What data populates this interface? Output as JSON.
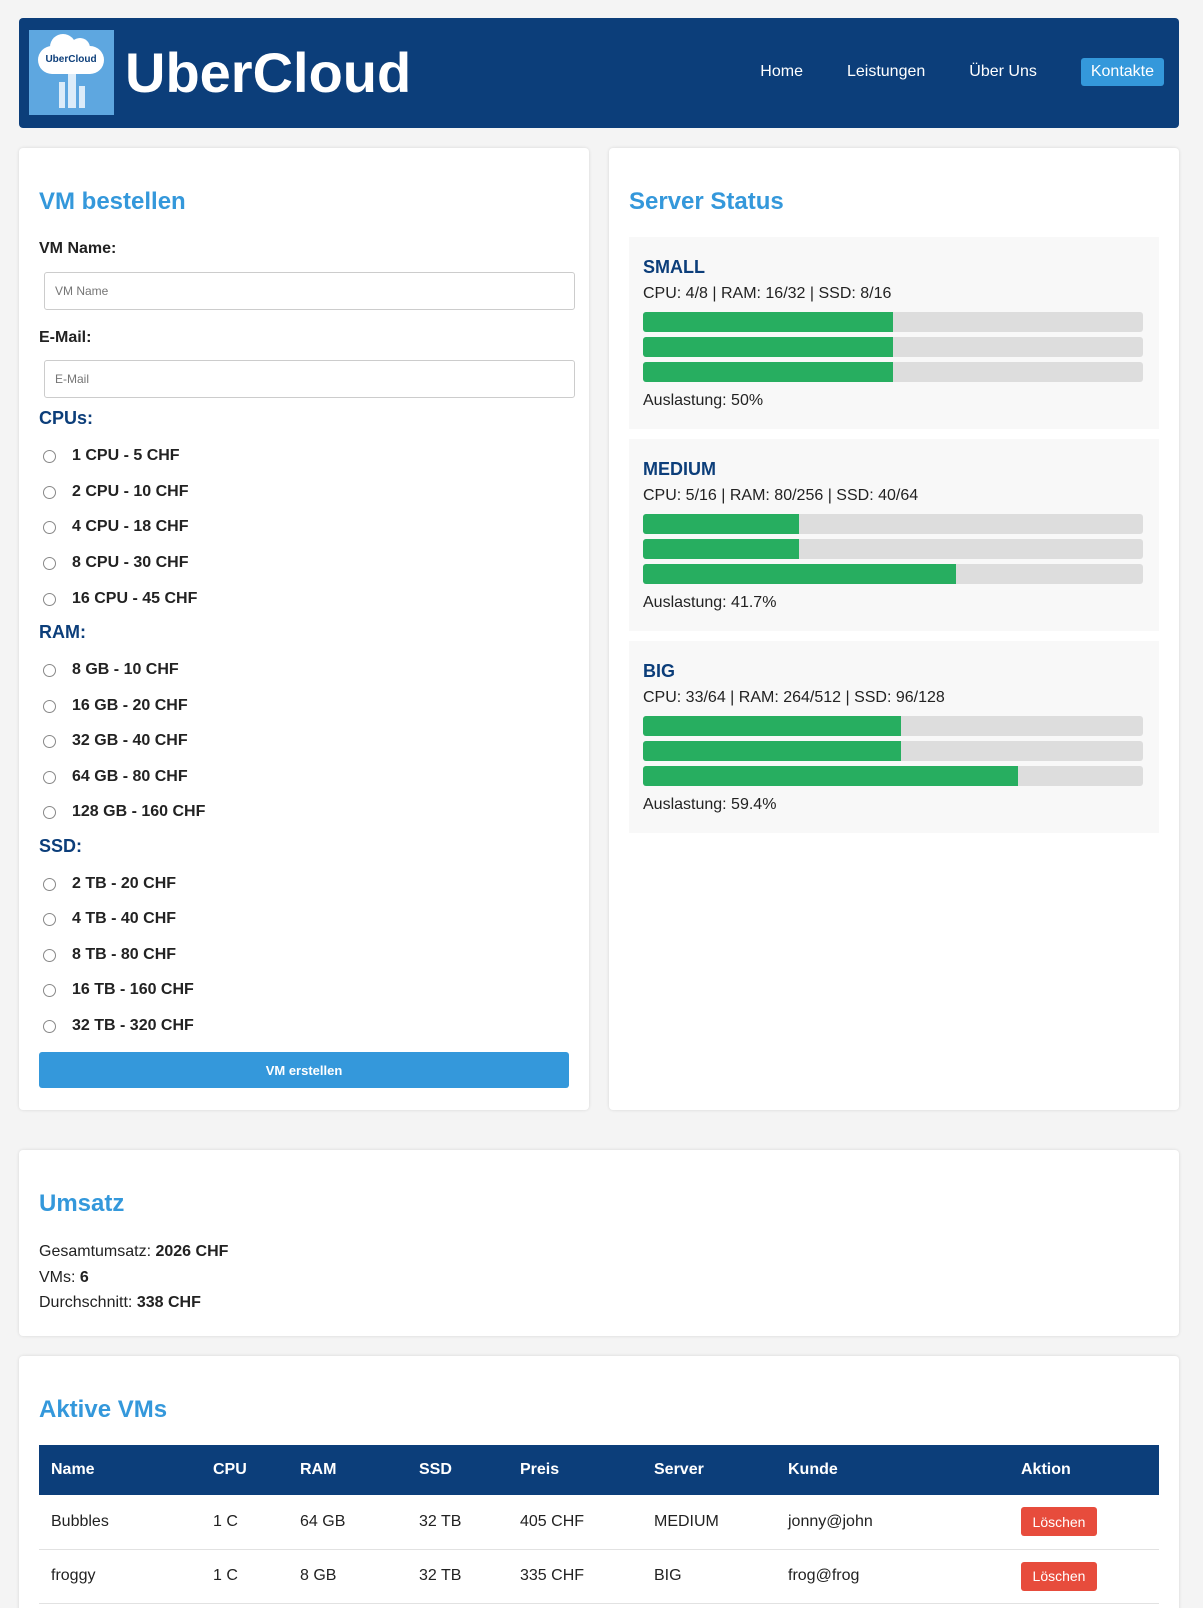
{
  "header": {
    "logo_text": "UberCloud",
    "brand": "UberCloud",
    "nav": [
      "Home",
      "Leistungen",
      "Über Uns",
      "Kontakte"
    ]
  },
  "order": {
    "title": "VM bestellen",
    "name_label": "VM Name:",
    "name_placeholder": "VM Name",
    "email_label": "E-Mail:",
    "email_placeholder": "E-Mail",
    "cpu_title": "CPUs:",
    "cpu_options": [
      "1 CPU - 5 CHF",
      "2 CPU - 10 CHF",
      "4 CPU - 18 CHF",
      "8 CPU - 30 CHF",
      "16 CPU - 45 CHF"
    ],
    "ram_title": "RAM:",
    "ram_options": [
      "8 GB - 10 CHF",
      "16 GB - 20 CHF",
      "32 GB - 40 CHF",
      "64 GB - 80 CHF",
      "128 GB - 160 CHF"
    ],
    "ssd_title": "SSD:",
    "ssd_options": [
      "2 TB - 20 CHF",
      "4 TB - 40 CHF",
      "8 TB - 80 CHF",
      "16 TB - 160 CHF",
      "32 TB - 320 CHF"
    ],
    "submit_label": "VM erstellen"
  },
  "status": {
    "title": "Server Status",
    "servers": [
      {
        "name": "SMALL",
        "specs": "CPU: 4/8 | RAM: 16/32 | SSD: 8/16",
        "usage": [
          0.5,
          0.5,
          0.5
        ],
        "util": "Auslastung: 50%"
      },
      {
        "name": "MEDIUM",
        "specs": "CPU: 5/16 | RAM: 80/256 | SSD: 40/64",
        "usage": [
          0.3125,
          0.3125,
          0.625
        ],
        "util": "Auslastung: 41.7%"
      },
      {
        "name": "BIG",
        "specs": "CPU: 33/64 | RAM: 264/512 | SSD: 96/128",
        "usage": [
          0.515625,
          0.515625,
          0.75
        ],
        "util": "Auslastung: 59.4%"
      }
    ]
  },
  "revenue": {
    "title": "Umsatz",
    "total_label": "Gesamtumsatz:",
    "total_value": "2026 CHF",
    "vms_label": "VMs:",
    "vms_value": "6",
    "avg_label": "Durchschnitt:",
    "avg_value": "338 CHF"
  },
  "vms": {
    "title": "Aktive VMs",
    "headers": [
      "Name",
      "CPU",
      "RAM",
      "SSD",
      "Preis",
      "Server",
      "Kunde",
      "Aktion"
    ],
    "rows": [
      {
        "name": "Bubbles",
        "cpu": "1 C",
        "ram": "64 GB",
        "ssd": "32 TB",
        "price": "405 CHF",
        "server": "MEDIUM",
        "customer": "jonny@john",
        "action": "Löschen"
      },
      {
        "name": "froggy",
        "cpu": "1 C",
        "ram": "8 GB",
        "ssd": "32 TB",
        "price": "335 CHF",
        "server": "BIG",
        "customer": "frog@frog",
        "action": "Löschen"
      }
    ]
  },
  "colors": {
    "navy": "#0c3e7a",
    "accent": "#3498db",
    "bar_fill": "#27ae60",
    "delete": "#e74c3c"
  }
}
